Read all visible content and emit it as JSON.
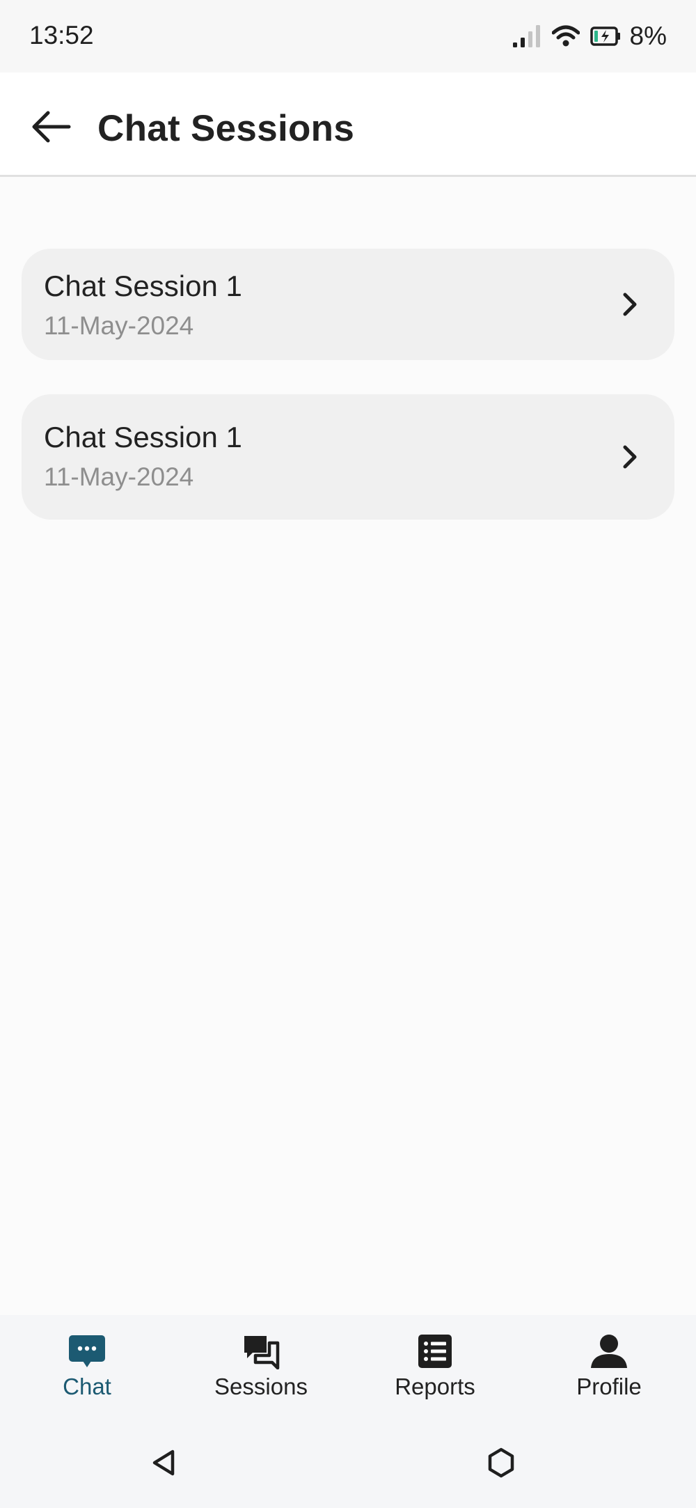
{
  "status_bar": {
    "time": "13:52",
    "battery": "8%",
    "icons": [
      "signal-icon",
      "wifi-icon",
      "battery-charging-icon"
    ]
  },
  "app_bar": {
    "title": "Chat Sessions",
    "back_icon": "arrow-left-icon"
  },
  "sessions": [
    {
      "title": "Chat Session 1",
      "date": "11-May-2024"
    },
    {
      "title": "Chat Session 1",
      "date": "11-May-2024"
    }
  ],
  "bottom_nav": {
    "items": [
      {
        "label": "Chat",
        "icon": "chat-bubble-icon",
        "active": true
      },
      {
        "label": "Sessions",
        "icon": "conversations-icon",
        "active": false
      },
      {
        "label": "Reports",
        "icon": "list-icon",
        "active": false
      },
      {
        "label": "Profile",
        "icon": "person-icon",
        "active": false
      }
    ]
  },
  "colors": {
    "accent": "#1c5a72",
    "card_bg": "#f0f0f0",
    "page_bg": "#fbfbfb",
    "date_text": "#8e8e8e"
  }
}
